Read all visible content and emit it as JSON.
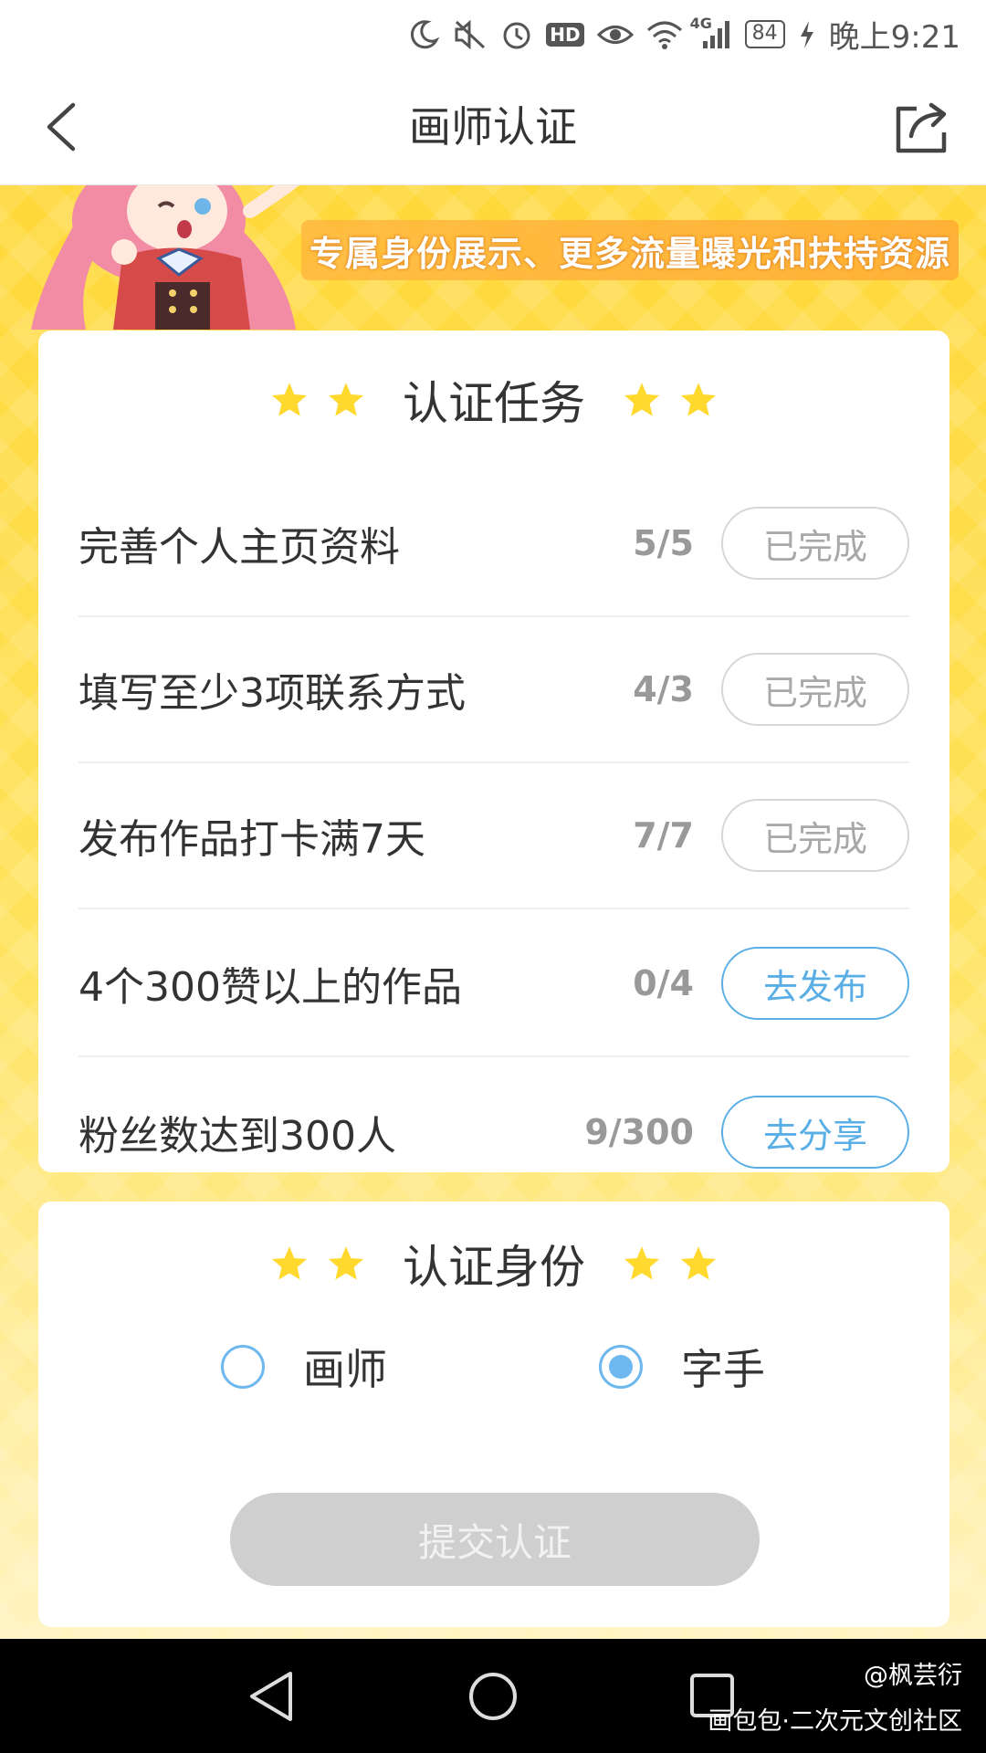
{
  "status_bar": {
    "hd_label": "HD",
    "network_label": "4G",
    "battery": "84",
    "time": "晚上9:21"
  },
  "nav": {
    "title": "画师认证",
    "back_icon": "chevron-left-icon",
    "share_icon": "share-icon"
  },
  "banner": {
    "text": "专属身份展示、更多流量曝光和扶持资源"
  },
  "tasks": {
    "title": "认证任务",
    "items": [
      {
        "label": "完善个人主页资料",
        "progress": "5/5",
        "button": "已完成",
        "status": "done"
      },
      {
        "label": "填写至少3项联系方式",
        "progress": "4/3",
        "button": "已完成",
        "status": "done"
      },
      {
        "label": "发布作品打卡满7天",
        "progress": "7/7",
        "button": "已完成",
        "status": "done"
      },
      {
        "label": "4个300赞以上的作品",
        "progress": "0/4",
        "button": "去发布",
        "status": "action"
      },
      {
        "label": "粉丝数达到300人",
        "progress": "9/300",
        "button": "去分享",
        "status": "action"
      }
    ]
  },
  "identity": {
    "title": "认证身份",
    "options": [
      {
        "label": "画师",
        "selected": false
      },
      {
        "label": "字手",
        "selected": true
      }
    ],
    "submit_label": "提交认证"
  },
  "watermark": {
    "line1": "@枫芸衍",
    "line2": "画包包·二次元文创社区"
  },
  "colors": {
    "accent_blue": "#5aaee6",
    "star_yellow": "#ffd92e",
    "bg_yellow": "#ffe04a",
    "disabled_gray": "#cfcfcf"
  }
}
